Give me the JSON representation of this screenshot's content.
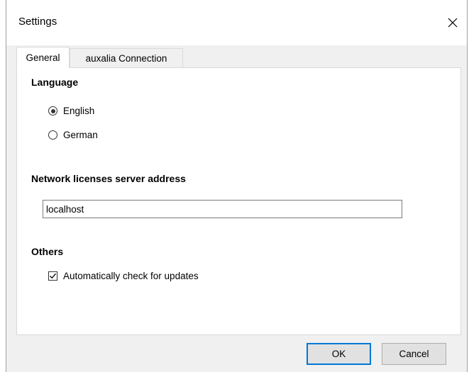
{
  "window": {
    "title": "Settings"
  },
  "tabs": [
    {
      "label": "General",
      "active": true
    },
    {
      "label": "auxalia Connection",
      "active": false
    }
  ],
  "language": {
    "heading": "Language",
    "options": [
      {
        "label": "English",
        "selected": true
      },
      {
        "label": "German",
        "selected": false
      }
    ]
  },
  "network": {
    "heading": "Network licenses server address",
    "server_value": "localhost"
  },
  "others": {
    "heading": "Others",
    "auto_update_label": "Automatically check for updates",
    "auto_update_checked": true
  },
  "buttons": {
    "ok": "OK",
    "cancel": "Cancel"
  },
  "colors": {
    "accent": "#0078d7",
    "window_bg": "#f0f0f0",
    "panel_bg": "#ffffff"
  }
}
